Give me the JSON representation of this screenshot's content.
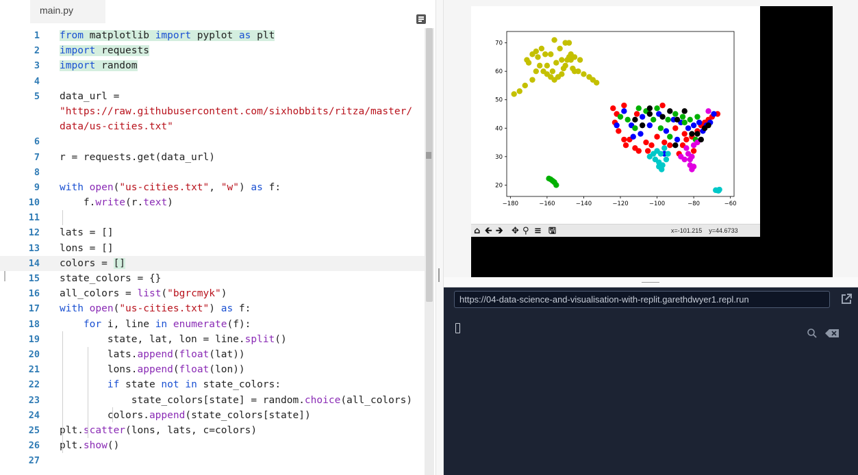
{
  "editor": {
    "tab": "main.py",
    "lines": [
      {
        "n": "1",
        "t": [
          {
            "s": "from",
            "c": "kw",
            "h": 1
          },
          {
            "s": " matplotlib ",
            "h": 1
          },
          {
            "s": "import",
            "c": "kw",
            "h": 1
          },
          {
            "s": " pyplot ",
            "h": 1
          },
          {
            "s": "as",
            "c": "kw",
            "h": 1
          },
          {
            "s": " plt",
            "h": 1
          }
        ]
      },
      {
        "n": "2",
        "t": [
          {
            "s": "import",
            "c": "kw",
            "h": 1
          },
          {
            "s": " requests",
            "h": 1
          }
        ]
      },
      {
        "n": "3",
        "t": [
          {
            "s": "import",
            "c": "kw",
            "h": 1
          },
          {
            "s": " random",
            "h": 1
          }
        ]
      },
      {
        "n": "4",
        "t": []
      },
      {
        "n": "5",
        "t": [
          {
            "s": "data_url ="
          }
        ]
      },
      {
        "n": "",
        "t": [
          {
            "s": "\"https://raw.githubusercontent.com/sixhobbits/ritza/master/",
            "c": "st"
          }
        ]
      },
      {
        "n": "",
        "t": [
          {
            "s": "data/us-cities.txt\"",
            "c": "st"
          }
        ]
      },
      {
        "n": "6",
        "t": []
      },
      {
        "n": "7",
        "t": [
          {
            "s": "r = requests.get(data_url)"
          }
        ]
      },
      {
        "n": "8",
        "t": []
      },
      {
        "n": "9",
        "t": [
          {
            "s": "with",
            "c": "kw"
          },
          {
            "s": " "
          },
          {
            "s": "open",
            "c": "fn"
          },
          {
            "s": "("
          },
          {
            "s": "\"us-cities.txt\"",
            "c": "st"
          },
          {
            "s": ", "
          },
          {
            "s": "\"w\"",
            "c": "st"
          },
          {
            "s": ") "
          },
          {
            "s": "as",
            "c": "kw"
          },
          {
            "s": " f:"
          }
        ]
      },
      {
        "n": "10",
        "t": [
          {
            "s": "    f."
          },
          {
            "s": "write",
            "c": "fn"
          },
          {
            "s": "(r."
          },
          {
            "s": "text",
            "c": "fn"
          },
          {
            "s": ")"
          }
        ]
      },
      {
        "n": "11",
        "t": []
      },
      {
        "n": "12",
        "t": [
          {
            "s": "lats = []"
          }
        ]
      },
      {
        "n": "13",
        "t": [
          {
            "s": "lons = []"
          }
        ]
      },
      {
        "n": "14",
        "t": [
          {
            "s": "colors = "
          },
          {
            "s": "[]",
            "h": 1
          }
        ]
      },
      {
        "n": "15",
        "t": [
          {
            "s": "state_colors = {}"
          }
        ]
      },
      {
        "n": "16",
        "t": [
          {
            "s": "all_colors = "
          },
          {
            "s": "list",
            "c": "fn"
          },
          {
            "s": "("
          },
          {
            "s": "\"bgrcmyk\"",
            "c": "st"
          },
          {
            "s": ")"
          }
        ]
      },
      {
        "n": "17",
        "t": [
          {
            "s": "with",
            "c": "kw"
          },
          {
            "s": " "
          },
          {
            "s": "open",
            "c": "fn"
          },
          {
            "s": "("
          },
          {
            "s": "\"us-cities.txt\"",
            "c": "st"
          },
          {
            "s": ") "
          },
          {
            "s": "as",
            "c": "kw"
          },
          {
            "s": " f:"
          }
        ]
      },
      {
        "n": "18",
        "t": [
          {
            "s": "    "
          },
          {
            "s": "for",
            "c": "kw"
          },
          {
            "s": " i, line "
          },
          {
            "s": "in",
            "c": "kw"
          },
          {
            "s": " "
          },
          {
            "s": "enumerate",
            "c": "fn"
          },
          {
            "s": "(f):"
          }
        ]
      },
      {
        "n": "19",
        "t": [
          {
            "s": "        state, lat, lon = line."
          },
          {
            "s": "split",
            "c": "fn"
          },
          {
            "s": "()"
          }
        ]
      },
      {
        "n": "20",
        "t": [
          {
            "s": "        lats."
          },
          {
            "s": "append",
            "c": "fn"
          },
          {
            "s": "("
          },
          {
            "s": "float",
            "c": "fn"
          },
          {
            "s": "(lat))"
          }
        ]
      },
      {
        "n": "21",
        "t": [
          {
            "s": "        lons."
          },
          {
            "s": "append",
            "c": "fn"
          },
          {
            "s": "("
          },
          {
            "s": "float",
            "c": "fn"
          },
          {
            "s": "(lon))"
          }
        ]
      },
      {
        "n": "22",
        "t": [
          {
            "s": "        "
          },
          {
            "s": "if",
            "c": "kw"
          },
          {
            "s": " state "
          },
          {
            "s": "not",
            "c": "kw"
          },
          {
            "s": " "
          },
          {
            "s": "in",
            "c": "kw"
          },
          {
            "s": " state_colors:"
          }
        ]
      },
      {
        "n": "23",
        "t": [
          {
            "s": "            state_colors[state] = random."
          },
          {
            "s": "choice",
            "c": "fn"
          },
          {
            "s": "(all_colors)"
          }
        ]
      },
      {
        "n": "24",
        "t": [
          {
            "s": "        colors."
          },
          {
            "s": "append",
            "c": "fn"
          },
          {
            "s": "(state_colors[state])"
          }
        ]
      },
      {
        "n": "25",
        "t": [
          {
            "s": "plt."
          },
          {
            "s": "scatter",
            "c": "fn"
          },
          {
            "s": "(lons, lats, c=colors)"
          }
        ]
      },
      {
        "n": "26",
        "t": [
          {
            "s": "plt."
          },
          {
            "s": "show",
            "c": "fn"
          },
          {
            "s": "()"
          }
        ]
      },
      {
        "n": "27",
        "t": []
      }
    ]
  },
  "plot": {
    "coord_readout": "x=-101.215    y=44.6733",
    "toolbar_icons": [
      "home-icon",
      "back-arrow-icon",
      "forward-arrow-icon",
      "pan-icon",
      "zoom-icon",
      "configure-subplots-icon",
      "save-icon"
    ]
  },
  "chart_data": {
    "type": "scatter",
    "xlim": [
      -182,
      -58
    ],
    "ylim": [
      16,
      74
    ],
    "xticks": [
      -180,
      -160,
      -140,
      -120,
      -100,
      -80,
      -60
    ],
    "yticks": [
      20,
      30,
      40,
      50,
      60,
      70
    ],
    "xtick_labels": [
      "−180",
      "−160",
      "−140",
      "−120",
      "−100",
      "−80",
      "−60"
    ],
    "ytick_labels": [
      "20",
      "30",
      "40",
      "50",
      "60",
      "70"
    ],
    "grid": false,
    "series": [
      {
        "color": "#c4c000",
        "points": [
          [
            -178,
            52
          ],
          [
            -175,
            53
          ],
          [
            -172,
            55
          ],
          [
            -168,
            57
          ],
          [
            -166,
            60
          ],
          [
            -164,
            62
          ],
          [
            -162,
            60
          ],
          [
            -160,
            59
          ],
          [
            -158,
            58
          ],
          [
            -156,
            57
          ],
          [
            -154,
            58
          ],
          [
            -152,
            59
          ],
          [
            -151,
            61
          ],
          [
            -150,
            62
          ],
          [
            -149,
            64
          ],
          [
            -148,
            65
          ],
          [
            -147,
            66
          ],
          [
            -146,
            61
          ],
          [
            -145,
            60
          ],
          [
            -143,
            60
          ],
          [
            -140,
            59
          ],
          [
            -137,
            58
          ],
          [
            -135,
            57
          ],
          [
            -133,
            56
          ],
          [
            -165,
            65
          ],
          [
            -163,
            68
          ],
          [
            -161,
            66
          ],
          [
            -158,
            66
          ],
          [
            -156,
            71
          ],
          [
            -153,
            68
          ],
          [
            -150,
            70
          ],
          [
            -148,
            70
          ],
          [
            -166,
            67
          ],
          [
            -160,
            62
          ],
          [
            -155,
            63
          ],
          [
            -152,
            64
          ],
          [
            -145,
            65
          ],
          [
            -142,
            64
          ],
          [
            -147,
            64
          ],
          [
            -157,
            60
          ],
          [
            -170,
            63
          ],
          [
            -168,
            66
          ],
          [
            -171,
            64
          ]
        ]
      },
      {
        "color": "#ff0000",
        "points": [
          [
            -124,
            47
          ],
          [
            -122,
            45
          ],
          [
            -123,
            42
          ],
          [
            -121,
            39
          ],
          [
            -118,
            36
          ],
          [
            -117,
            34
          ],
          [
            -115,
            36
          ],
          [
            -112,
            33
          ],
          [
            -110,
            32
          ],
          [
            -106,
            35
          ],
          [
            -105,
            32
          ],
          [
            -103,
            34
          ],
          [
            -100,
            37
          ],
          [
            -96,
            35
          ],
          [
            -93,
            34
          ],
          [
            -88,
            31
          ],
          [
            -86,
            34
          ],
          [
            -84,
            36
          ],
          [
            -81,
            37
          ],
          [
            -78,
            39
          ],
          [
            -76,
            41
          ],
          [
            -74,
            42
          ],
          [
            -72,
            43
          ],
          [
            -70,
            44
          ],
          [
            -118,
            48
          ],
          [
            -111,
            45
          ],
          [
            -97,
            48
          ],
          [
            -90,
            40
          ],
          [
            -85,
            38
          ],
          [
            -80,
            32
          ],
          [
            -67,
            45
          ]
        ]
      },
      {
        "color": "#0000ff",
        "points": [
          [
            -122,
            41
          ],
          [
            -118,
            46
          ],
          [
            -114,
            41
          ],
          [
            -109,
            38
          ],
          [
            -104,
            41
          ],
          [
            -99,
            45
          ],
          [
            -95,
            39
          ],
          [
            -91,
            43
          ],
          [
            -87,
            42
          ],
          [
            -83,
            40
          ],
          [
            -80,
            41
          ],
          [
            -77,
            42
          ],
          [
            -75,
            39
          ],
          [
            -73,
            41
          ],
          [
            -71,
            42
          ],
          [
            -69,
            45
          ],
          [
            -113,
            37
          ],
          [
            -108,
            44
          ],
          [
            -96,
            31
          ],
          [
            -89,
            36
          ]
        ]
      },
      {
        "color": "#00b000",
        "points": [
          [
            -120,
            44
          ],
          [
            -116,
            43
          ],
          [
            -112,
            40
          ],
          [
            -106,
            46
          ],
          [
            -102,
            43
          ],
          [
            -98,
            40
          ],
          [
            -94,
            43
          ],
          [
            -90,
            45
          ],
          [
            -86,
            44
          ],
          [
            -82,
            43
          ],
          [
            -78,
            44
          ],
          [
            -110,
            47
          ],
          [
            -100,
            47
          ],
          [
            -93,
            37
          ],
          [
            -85,
            42
          ],
          [
            -79,
            36
          ],
          [
            -158,
            22
          ],
          [
            -157,
            21.5
          ],
          [
            -156,
            21
          ],
          [
            -155,
            20
          ],
          [
            -159,
            22.3
          ]
        ]
      },
      {
        "color": "#00c8c8",
        "points": [
          [
            -104,
            30
          ],
          [
            -101,
            29
          ],
          [
            -99,
            28
          ],
          [
            -97,
            27
          ],
          [
            -95,
            29
          ],
          [
            -98,
            31
          ],
          [
            -100,
            32
          ],
          [
            -102,
            31
          ],
          [
            -96,
            33
          ],
          [
            -94,
            31
          ],
          [
            -99,
            26.5
          ],
          [
            -97.5,
            25.5
          ],
          [
            -68,
            18.2
          ],
          [
            -67,
            18.1
          ],
          [
            -66,
            18.4
          ],
          [
            -66.5,
            18
          ]
        ]
      },
      {
        "color": "#e000e0",
        "points": [
          [
            -82,
            27
          ],
          [
            -81,
            25.5
          ],
          [
            -80,
            26.5
          ],
          [
            -82,
            29
          ],
          [
            -83,
            31
          ],
          [
            -81,
            30
          ],
          [
            -85,
            29
          ],
          [
            -87,
            30
          ],
          [
            -84,
            33
          ],
          [
            -80,
            34
          ],
          [
            -78,
            35
          ],
          [
            -72,
            46
          ]
        ]
      },
      {
        "color": "#000000",
        "points": [
          [
            -112,
            43
          ],
          [
            -108,
            41
          ],
          [
            -104,
            45
          ],
          [
            -97,
            44
          ],
          [
            -93,
            46
          ],
          [
            -89,
            43
          ],
          [
            -85,
            46
          ],
          [
            -81,
            38
          ],
          [
            -78,
            38
          ],
          [
            -76,
            36
          ],
          [
            -72,
            41
          ],
          [
            -104,
            47
          ],
          [
            -90,
            34
          ],
          [
            -74,
            40
          ]
        ]
      }
    ]
  },
  "console": {
    "url": "https://04-data-science-and-visualisation-with-replit.garethdwyer1.repl.run"
  }
}
